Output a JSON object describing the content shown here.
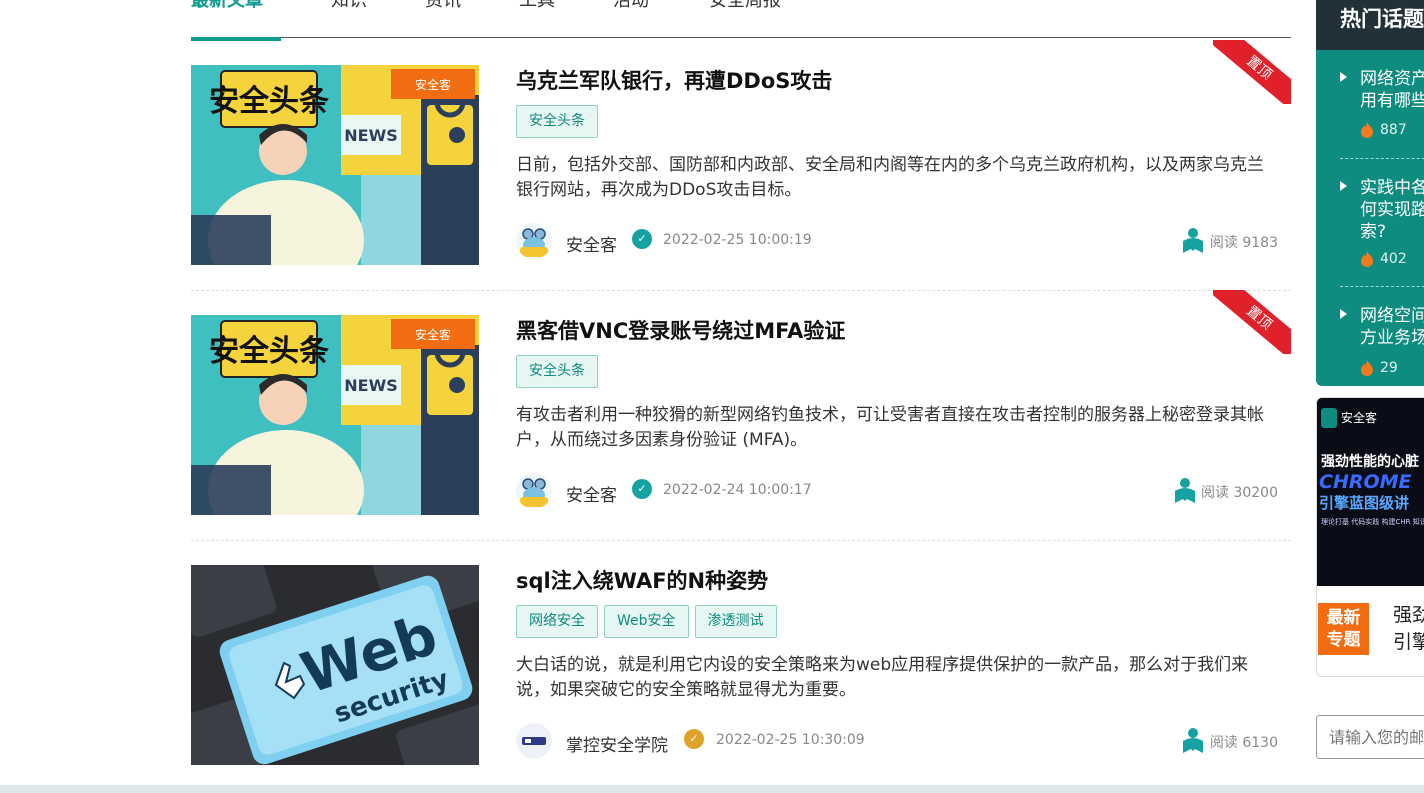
{
  "tabs": [
    "最新文章",
    "知识",
    "资讯",
    "工具",
    "活动",
    "安全周报"
  ],
  "articles": [
    {
      "title": "乌克兰军队银行，再遭DDoS攻击",
      "tags": [
        "安全头条"
      ],
      "summary": "日前，包括外交部、国防部和内政部、安全局和内阁等在内的多个乌克兰政府机构，以及两家乌克兰银行网站，再次成为DDoS攻击目标。",
      "author": "安全客",
      "date": "2022-02-25 10:00:19",
      "reads": "阅读 9183",
      "pinned": "置顶",
      "thumb_text": "安全头条",
      "thumb_brand": "安全客",
      "thumb_news": "NEWS"
    },
    {
      "title": "黑客借VNC登录账号绕过MFA验证",
      "tags": [
        "安全头条"
      ],
      "summary": "有攻击者利用一种狡猾的新型网络钓鱼技术，可让受害者直接在攻击者控制的服务器上秘密登录其帐户，从而绕过多因素身份验证 (MFA)。",
      "author": "安全客",
      "date": "2022-02-24 10:00:17",
      "reads": "阅读 30200",
      "pinned": "置顶",
      "thumb_text": "安全头条",
      "thumb_brand": "安全客",
      "thumb_news": "NEWS"
    },
    {
      "title": "sql注入绕WAF的N种姿势",
      "tags": [
        "网络安全",
        "Web安全",
        "渗透测试"
      ],
      "summary": "大白话的说，就是利用它内设的安全策略来为web应用程序提供保护的一款产品，那么对于我们来说，如果突破它的安全策略就显得尤为重要。",
      "author": "掌控安全学院",
      "date": "2022-02-25 10:30:09",
      "reads": "阅读 6130",
      "thumb_text": "Web",
      "thumb_sub": "security"
    }
  ],
  "sidebar": {
    "hot_title": "热门话题",
    "hot_items": [
      {
        "text": "网络资产\n用有哪些",
        "count": "887"
      },
      {
        "text": "实践中各\n何实现路\n索?",
        "count": "402"
      },
      {
        "text": "网络空间\n方业务场",
        "count": "29"
      }
    ],
    "special": {
      "brand": "安全客",
      "banner_line1": "强劲性能的心脏",
      "banner_line2": "CHROME",
      "banner_line3": "引擎蓝图级讲",
      "banner_desc": "理论打基 代码实践 构建CHR\n知识体系的摩天大厦!",
      "badge": "最新\n专题",
      "title": "强劲\n引擎"
    },
    "subscribe_placeholder": "请输入您的邮箱"
  },
  "colors": {
    "accent": "#0f9b8e",
    "pin": "#e0202a",
    "hot_bg": "#0e8c80",
    "verify_teal": "#17a2a2",
    "verify_gold": "#e0a32a",
    "badge_orange": "#f26c12"
  }
}
